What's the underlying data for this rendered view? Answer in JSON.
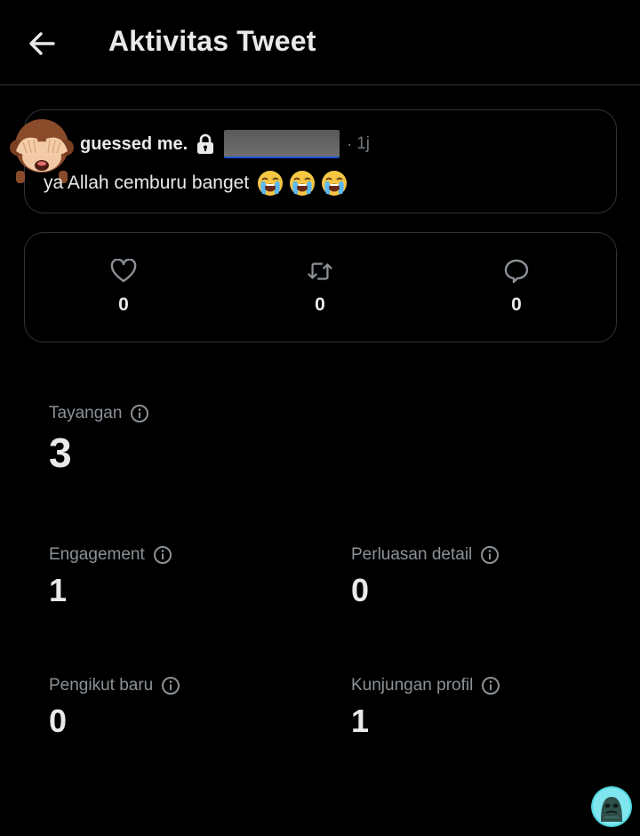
{
  "header": {
    "title": "Aktivitas Tweet",
    "back_icon": "arrow-left-icon"
  },
  "tweet": {
    "display_name": "guessed me.",
    "dot": "·",
    "time": "1j",
    "text": "ya Allah cemburu banget",
    "emojis": [
      "loudly-crying-face",
      "loudly-crying-face",
      "loudly-crying-face"
    ],
    "avatar_icon": "see-no-evil-monkey-icon",
    "lock_icon": "lock-icon"
  },
  "engagement_bar": {
    "likes": "0",
    "retweets": "0",
    "replies": "0"
  },
  "metrics": {
    "views": {
      "label": "Tayangan",
      "value": "3"
    },
    "engagement": {
      "label": "Engagement",
      "value": "1"
    },
    "detail_expands": {
      "label": "Perluasan detail",
      "value": "0"
    },
    "new_followers": {
      "label": "Pengikut baru",
      "value": "0"
    },
    "profile_visits": {
      "label": "Kunjungan profil",
      "value": "1"
    }
  },
  "colors": {
    "background": "#000000",
    "text": "#e7e9ea",
    "muted": "#8b9196",
    "border": "#2f3336"
  }
}
